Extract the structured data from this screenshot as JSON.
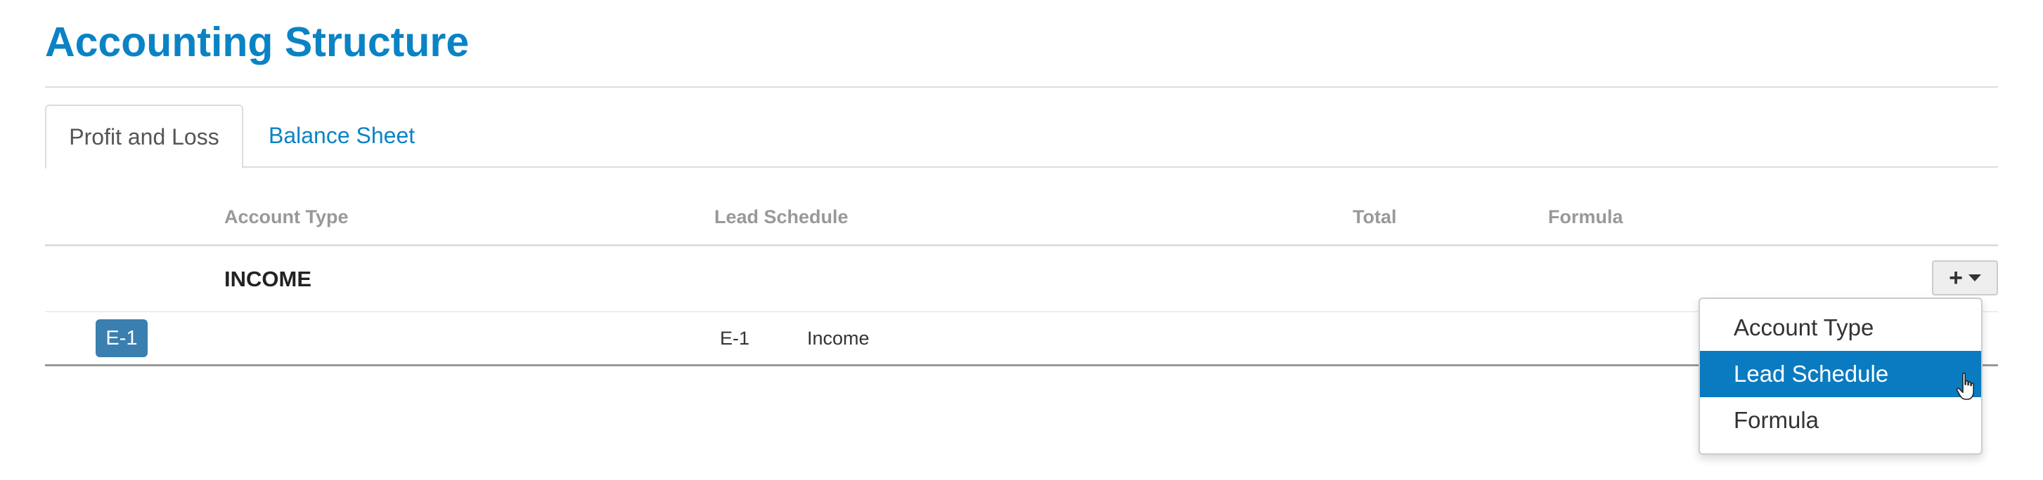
{
  "page": {
    "title": "Accounting Structure"
  },
  "tabs": [
    {
      "label": "Profit and Loss",
      "active": true
    },
    {
      "label": "Balance Sheet",
      "active": false
    }
  ],
  "table": {
    "columns": [
      "Account Type",
      "Lead Schedule",
      "Total",
      "Formula"
    ],
    "rows": [
      {
        "type": "group",
        "account_type": "INCOME"
      },
      {
        "type": "item",
        "badge": "E-1",
        "lead_code": "E-1",
        "lead_name": "Income"
      }
    ]
  },
  "add_button": {
    "icon": "plus-icon",
    "caret": "caret-down-icon"
  },
  "dropdown": {
    "items": [
      "Account Type",
      "Lead Schedule",
      "Formula"
    ],
    "selected_index": 1
  },
  "colors": {
    "accent": "#0a83c5",
    "badge": "#3a7fb0",
    "selected_item": "#0a7bc1",
    "header_text": "#999999"
  }
}
